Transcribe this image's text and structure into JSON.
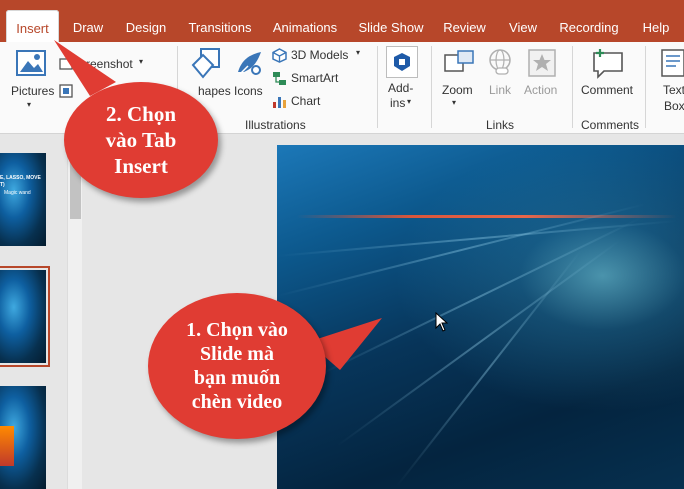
{
  "tabs": [
    {
      "label": "Insert",
      "active": true
    },
    {
      "label": "Draw"
    },
    {
      "label": "Design"
    },
    {
      "label": "Transitions"
    },
    {
      "label": "Animations"
    },
    {
      "label": "Slide Show"
    },
    {
      "label": "Review"
    },
    {
      "label": "View"
    },
    {
      "label": "Recording"
    },
    {
      "label": "Help"
    }
  ],
  "ribbon": {
    "pictures": "Pictures",
    "screenshot": "creenshot",
    "shapes": "hapes",
    "icons": "Icons",
    "models3d": "3D Models",
    "smartart": "SmartArt",
    "chart": "Chart",
    "illustrations_group": "Illustrations",
    "addins_line1": "Add-",
    "addins_line2": "ins",
    "zoom": "Zoom",
    "link": "Link",
    "action": "Action",
    "links_group": "Links",
    "comment": "Comment",
    "comments_group": "Comments",
    "textbox_line1": "Text",
    "textbox_line2": "Box"
  },
  "thumb1_text": {
    "line1": "E, LASSO, MOVE",
    "line2": "T)",
    "line3": "Magic wand"
  },
  "callouts": {
    "tab": [
      "2. Chọn",
      "vào Tab",
      "Insert"
    ],
    "slide": [
      "1. Chọn vào",
      "Slide mà",
      "bạn muốn",
      "chèn video"
    ]
  },
  "colors": {
    "accent": "#b7472a",
    "callout": "#e03c33"
  }
}
